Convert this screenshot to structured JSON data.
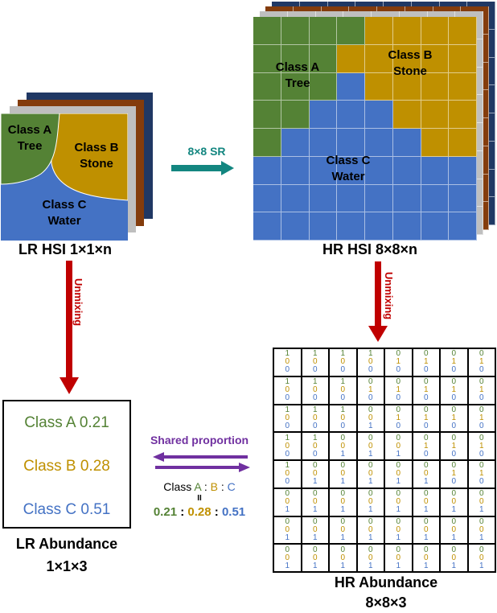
{
  "colors": {
    "classA": "#548235",
    "classB": "#bf9000",
    "classC": "#4472c4",
    "layer_gray": "#bfbfbf",
    "layer_brown": "#843c0c",
    "layer_navy": "#203864",
    "unmixing_arrow": "#c00000",
    "sr_arrow": "#138680",
    "shared_arrow": "#7030a0"
  },
  "lr_hsi": {
    "regions": {
      "a": {
        "line1": "Class A",
        "line2": "Tree"
      },
      "b": {
        "line1": "Class B",
        "line2": "Stone"
      },
      "c": {
        "line1": "Class C",
        "line2": "Water"
      }
    },
    "caption": "LR HSI 1×1×n"
  },
  "sr_arrow": {
    "label": "8×8 SR"
  },
  "hr_hsi": {
    "grid": [
      [
        "A",
        "A",
        "A",
        "A",
        "B",
        "B",
        "B",
        "B"
      ],
      [
        "A",
        "A",
        "A",
        "B",
        "B",
        "B",
        "B",
        "B"
      ],
      [
        "A",
        "A",
        "A",
        "C",
        "B",
        "B",
        "B",
        "B"
      ],
      [
        "A",
        "A",
        "C",
        "C",
        "C",
        "B",
        "B",
        "B"
      ],
      [
        "A",
        "C",
        "C",
        "C",
        "C",
        "C",
        "B",
        "B"
      ],
      [
        "C",
        "C",
        "C",
        "C",
        "C",
        "C",
        "C",
        "C"
      ],
      [
        "C",
        "C",
        "C",
        "C",
        "C",
        "C",
        "C",
        "C"
      ],
      [
        "C",
        "C",
        "C",
        "C",
        "C",
        "C",
        "C",
        "C"
      ]
    ],
    "regions": {
      "a": {
        "line1": "Class A",
        "line2": "Tree"
      },
      "b": {
        "line1": "Class B",
        "line2": "Stone"
      },
      "c": {
        "line1": "Class C",
        "line2": "Water"
      }
    },
    "caption": "HR HSI 8×8×n"
  },
  "unmixing_left": {
    "label": "Unmixing"
  },
  "unmixing_right": {
    "label": "Unmixing"
  },
  "lr_abundance": {
    "items": [
      {
        "text": "Class A 0.21",
        "cls": "A"
      },
      {
        "text": "Class B 0.28",
        "cls": "B"
      },
      {
        "text": "Class C 0.51",
        "cls": "C"
      }
    ],
    "caption_line1": "LR Abundance",
    "caption_line2": "1×1×3"
  },
  "shared": {
    "title": "Shared proportion",
    "ratio_prefix": "Class ",
    "ratio_a": "A",
    "ratio_sep1": " : ",
    "ratio_b": "B",
    "ratio_sep2": " : ",
    "ratio_c": "C",
    "equals": "II",
    "val_a": "0.21",
    "val_sep1": " : ",
    "val_b": "0.28",
    "val_sep2": " : ",
    "val_c": "0.51"
  },
  "hr_abundance": {
    "caption_line1": "HR Abundance",
    "caption_line2": "8×8×3"
  }
}
